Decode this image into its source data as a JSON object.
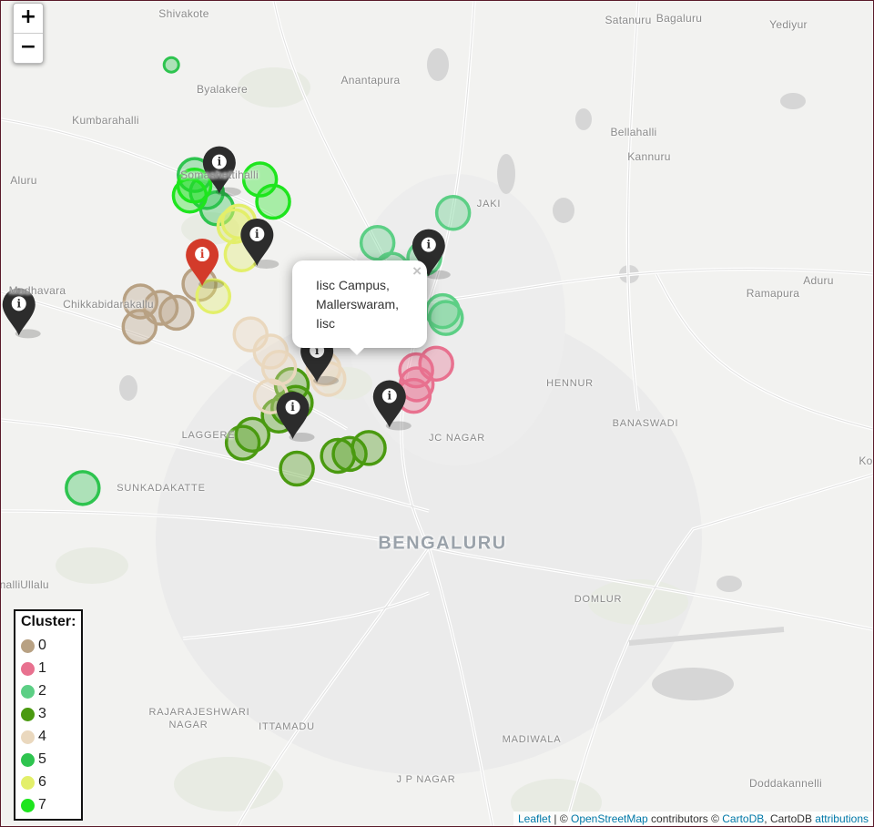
{
  "map": {
    "zoom_in_label": "+",
    "zoom_out_label": "−",
    "places": [
      {
        "name": "Shivakote",
        "cls": ""
      },
      {
        "name": "Satanuru",
        "cls": ""
      },
      {
        "name": "Bagaluru",
        "cls": ""
      },
      {
        "name": "Yediyur",
        "cls": ""
      },
      {
        "name": "Byalakere",
        "cls": ""
      },
      {
        "name": "Anantapura",
        "cls": ""
      },
      {
        "name": "Kumbarahalli",
        "cls": ""
      },
      {
        "name": "Bellahalli",
        "cls": ""
      },
      {
        "name": "Kannuru",
        "cls": ""
      },
      {
        "name": "Somashettihalli",
        "cls": ""
      },
      {
        "name": "Aluru",
        "cls": ""
      },
      {
        "name": "JAKI",
        "cls": "small"
      },
      {
        "name": "Aduru",
        "cls": ""
      },
      {
        "name": "Madhavara",
        "cls": ""
      },
      {
        "name": "Chikkabidarakallu",
        "cls": ""
      },
      {
        "name": "Ramapura",
        "cls": ""
      },
      {
        "name": "HENNUR",
        "cls": "small"
      },
      {
        "name": "BANASWADI",
        "cls": "small"
      },
      {
        "name": "LAGGERE",
        "cls": "small"
      },
      {
        "name": "JC NAGAR",
        "cls": "small"
      },
      {
        "name": "SUNKADAKATTE",
        "cls": "small"
      },
      {
        "name": "BENGALURU",
        "cls": "city"
      },
      {
        "name": "Ullalu",
        "cls": ""
      },
      {
        "name": "nalli",
        "cls": ""
      },
      {
        "name": "DOMLUR",
        "cls": "small"
      },
      {
        "name": "RAJARAJESHWARI",
        "cls": "small"
      },
      {
        "name": "NAGAR",
        "cls": "small"
      },
      {
        "name": "ITTAMADU",
        "cls": "small"
      },
      {
        "name": "MADIWALA",
        "cls": "small"
      },
      {
        "name": "J P NAGAR",
        "cls": "small"
      },
      {
        "name": "Doddakannelli",
        "cls": ""
      },
      {
        "name": "Ko",
        "cls": ""
      }
    ],
    "cluster_colors": [
      "#b8a183",
      "#e8718f",
      "#5ccf85",
      "#4a9a10",
      "#ead8be",
      "#2ec44f",
      "#e3ef6a",
      "#1ee51e"
    ],
    "circles": [
      {
        "cluster": 0,
        "lat": 13.0105,
        "lon": 77.5662
      },
      {
        "cluster": 0,
        "lat": 13.0031,
        "lon": 77.5406
      },
      {
        "cluster": 0,
        "lat": 13.0004,
        "lon": 77.5494
      },
      {
        "cluster": 0,
        "lat": 12.9983,
        "lon": 77.5562
      },
      {
        "cluster": 0,
        "lat": 12.9924,
        "lon": 77.5402
      },
      {
        "cluster": 1,
        "lat": 12.974,
        "lon": 77.6603
      },
      {
        "cluster": 1,
        "lat": 12.9768,
        "lon": 77.669
      },
      {
        "cluster": 1,
        "lat": 12.9681,
        "lon": 77.6605
      },
      {
        "cluster": 1,
        "lat": 12.9632,
        "lon": 77.6592
      },
      {
        "cluster": 2,
        "lat": 13.0405,
        "lon": 77.6763
      },
      {
        "cluster": 2,
        "lat": 13.0278,
        "lon": 77.6435
      },
      {
        "cluster": 2,
        "lat": 13.0214,
        "lon": 77.6638
      },
      {
        "cluster": 2,
        "lat": 13.0165,
        "lon": 77.6497
      },
      {
        "cluster": 2,
        "lat": 13.0091,
        "lon": 77.6482
      },
      {
        "cluster": 2,
        "lat": 13.008,
        "lon": 77.6572
      },
      {
        "cluster": 2,
        "lat": 12.999,
        "lon": 77.6718
      },
      {
        "cluster": 2,
        "lat": 12.9961,
        "lon": 77.6732
      },
      {
        "cluster": 3,
        "lat": 12.9678,
        "lon": 77.6063
      },
      {
        "cluster": 3,
        "lat": 12.9603,
        "lon": 77.608
      },
      {
        "cluster": 3,
        "lat": 12.9581,
        "lon": 77.6048
      },
      {
        "cluster": 3,
        "lat": 12.9549,
        "lon": 77.6006
      },
      {
        "cluster": 3,
        "lat": 12.9468,
        "lon": 77.5892
      },
      {
        "cluster": 3,
        "lat": 12.9434,
        "lon": 77.585
      },
      {
        "cluster": 3,
        "lat": 12.9412,
        "lon": 77.6397
      },
      {
        "cluster": 3,
        "lat": 12.9387,
        "lon": 77.6314
      },
      {
        "cluster": 3,
        "lat": 12.9379,
        "lon": 77.6263
      },
      {
        "cluster": 3,
        "lat": 12.9325,
        "lon": 77.6085
      },
      {
        "cluster": 4,
        "lat": 12.9892,
        "lon": 77.5884
      },
      {
        "cluster": 4,
        "lat": 12.9926,
        "lon": 77.6255
      },
      {
        "cluster": 4,
        "lat": 12.9975,
        "lon": 77.6249
      },
      {
        "cluster": 4,
        "lat": 12.9819,
        "lon": 77.5971
      },
      {
        "cluster": 4,
        "lat": 12.9751,
        "lon": 77.6008
      },
      {
        "cluster": 4,
        "lat": 12.9747,
        "lon": 77.6201
      },
      {
        "cluster": 4,
        "lat": 12.9704,
        "lon": 77.6222
      },
      {
        "cluster": 4,
        "lat": 12.963,
        "lon": 77.5972
      },
      {
        "cluster": 5,
        "lat": 13.103,
        "lon": 77.554
      },
      {
        "cluster": 5,
        "lat": 13.0565,
        "lon": 77.5641
      },
      {
        "cluster": 5,
        "lat": 13.0493,
        "lon": 77.5694
      },
      {
        "cluster": 5,
        "lat": 13.0424,
        "lon": 77.5738
      },
      {
        "cluster": 5,
        "lat": 12.9243,
        "lon": 77.5155
      },
      {
        "cluster": 6,
        "lat": 13.0368,
        "lon": 77.5833
      },
      {
        "cluster": 6,
        "lat": 13.0349,
        "lon": 77.5814
      },
      {
        "cluster": 6,
        "lat": 13.023,
        "lon": 77.5845
      },
      {
        "cluster": 6,
        "lat": 13.0053,
        "lon": 77.5722
      },
      {
        "cluster": 7,
        "lat": 13.052,
        "lon": 77.564
      },
      {
        "cluster": 7,
        "lat": 13.0478,
        "lon": 77.562
      },
      {
        "cluster": 7,
        "lat": 13.0546,
        "lon": 77.5925
      },
      {
        "cluster": 7,
        "lat": 13.0452,
        "lon": 77.5982
      }
    ],
    "markers": [
      {
        "lat": 13.0486,
        "lon": 77.5748,
        "color": "#2c2c2c"
      },
      {
        "lat": 13.0181,
        "lon": 77.5912,
        "color": "#2c2c2c"
      },
      {
        "lat": 13.0136,
        "lon": 77.6657,
        "color": "#2c2c2c"
      },
      {
        "lat": 13.0096,
        "lon": 77.5674,
        "color": "#d33b2a",
        "selected": true
      },
      {
        "lat": 12.9887,
        "lon": 77.4878,
        "color": "#2c2c2c"
      },
      {
        "lat": 12.9689,
        "lon": 77.6172,
        "color": "#2c2c2c"
      },
      {
        "lat": 12.9498,
        "lon": 77.6487,
        "color": "#2c2c2c"
      },
      {
        "lat": 12.945,
        "lon": 77.6067,
        "color": "#2c2c2c"
      }
    ],
    "marker_icon_glyph": "i",
    "popup": {
      "lines": [
        "Iisc Campus,",
        "Mallerswaram,",
        "Iisc"
      ],
      "close_label": "×"
    }
  },
  "legend": {
    "title": "Cluster:",
    "items": [
      {
        "label": "0",
        "color": "#b8a183"
      },
      {
        "label": "1",
        "color": "#e8718f"
      },
      {
        "label": "2",
        "color": "#5ccf85"
      },
      {
        "label": "3",
        "color": "#4a9a10"
      },
      {
        "label": "4",
        "color": "#ead8be"
      },
      {
        "label": "5",
        "color": "#2ec44f"
      },
      {
        "label": "6",
        "color": "#e3ef6a"
      },
      {
        "label": "7",
        "color": "#1ee51e"
      }
    ]
  },
  "attribution": {
    "leaflet": "Leaflet",
    "sep": " | © ",
    "osm": "OpenStreetMap",
    "contributors": " contributors © ",
    "carto": "CartoDB",
    "carto2": ", CartoDB ",
    "attributions": "attributions"
  }
}
